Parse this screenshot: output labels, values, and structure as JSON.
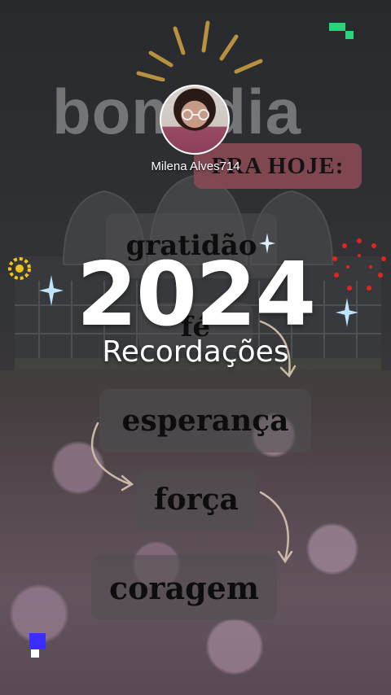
{
  "story": {
    "background_text": "bom dia",
    "user_name": "Milena Alves714",
    "title": "2024",
    "subtitle": "Recordações",
    "banner": "PRA HOJE:",
    "words": [
      "gratidão",
      "fé",
      "esperança",
      "força",
      "coragem"
    ]
  },
  "colors": {
    "banner": "#8a4a55",
    "title_text": "#ffffff",
    "word_text": "#0d0d0d",
    "sparkle": "#bfe4ff",
    "dots": "#e0261e",
    "corner_green": "#2bd37a",
    "corner_blue": "#3b2cff"
  },
  "icons": [
    "sun-rays-icon",
    "sparkle-icon",
    "sunflower-icon",
    "red-dots-icon",
    "arrow-icon"
  ]
}
